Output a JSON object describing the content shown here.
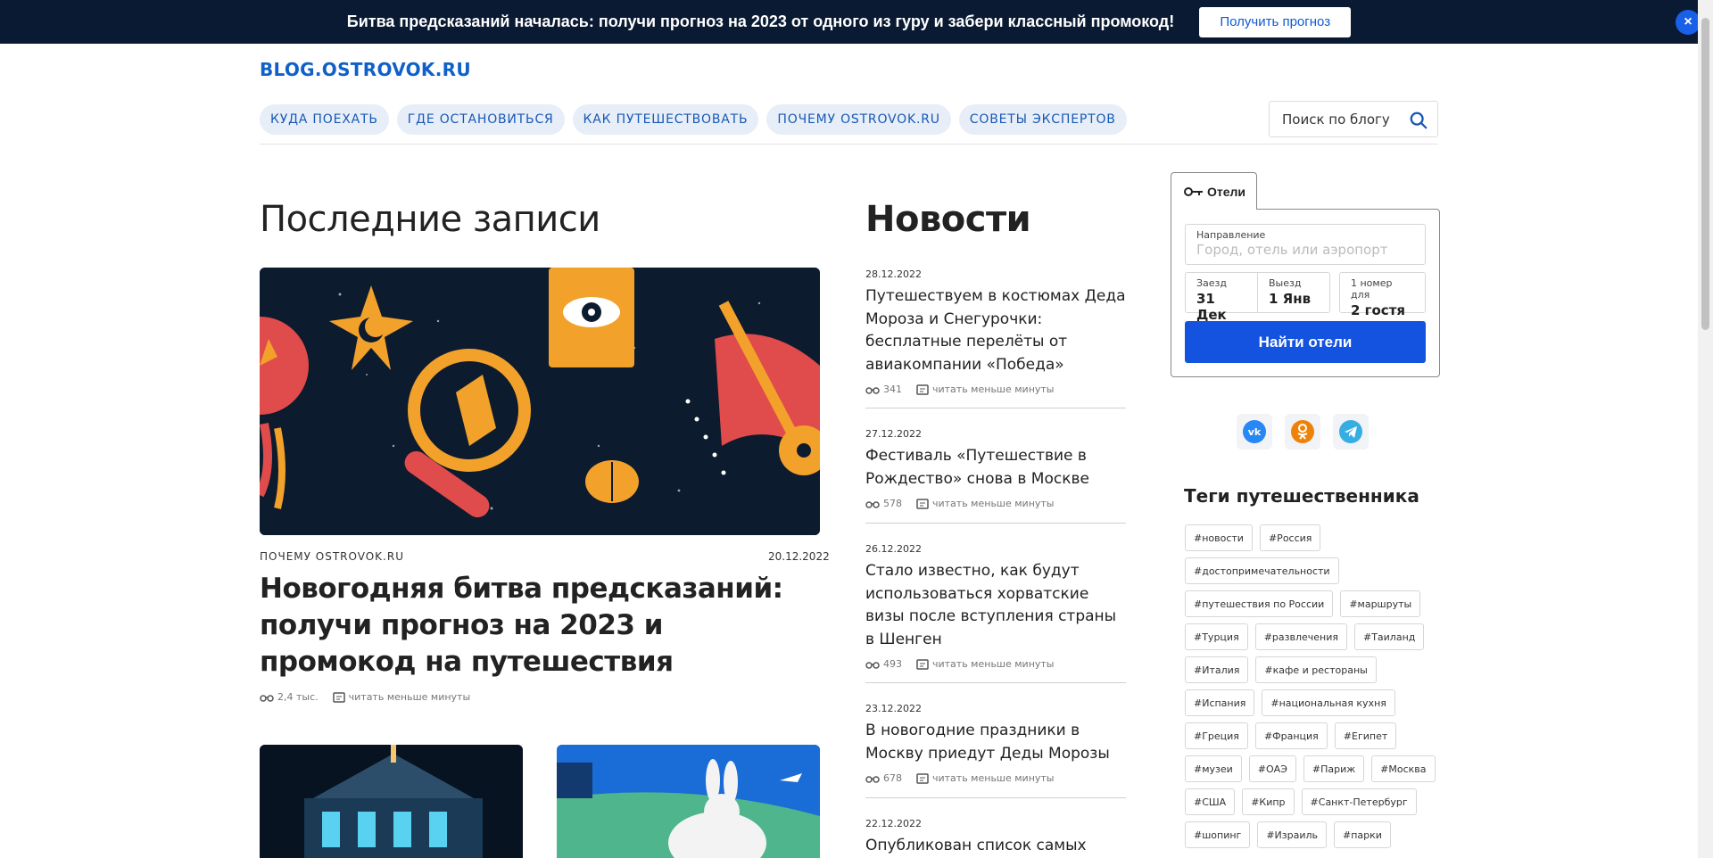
{
  "promo": {
    "text": "Битва предсказаний началась: получи прогноз на 2023 от одного из гуру и забери классный промокод!",
    "button": "Получить прогноз",
    "close": "×"
  },
  "header": {
    "logo": "BLOG.OSTROVOK.RU",
    "nav": [
      "КУДА ПОЕХАТЬ",
      "ГДЕ ОСТАНОВИТЬСЯ",
      "КАК ПУТЕШЕСТВОВАТЬ",
      "ПОЧЕМУ OSTROVOK.RU",
      "СОВЕТЫ ЭКСПЕРТОВ"
    ],
    "search_placeholder": "Поиск по блогу"
  },
  "latest": {
    "heading": "Последние записи",
    "featured": {
      "category": "ПОЧЕМУ OSTROVOK.RU",
      "date": "20.12.2022",
      "title": "Новогодняя битва предсказаний: получи прогноз на 2023 и промокод на путешествия",
      "views": "2,4 тыс.",
      "read_time": "читать меньше минуты"
    }
  },
  "news": {
    "heading": "Новости",
    "items": [
      {
        "date": "28.12.2022",
        "title": "Путешествуем в костюмах Деда Мороза и Снегурочки: бесплатные перелёты от авиакомпании «Победа»",
        "views": "341",
        "read_time": "читать меньше минуты"
      },
      {
        "date": "27.12.2022",
        "title": "Фестиваль «Путешествие в Рождество» снова в Москве",
        "views": "578",
        "read_time": "читать меньше минуты"
      },
      {
        "date": "26.12.2022",
        "title": "Стало известно, как будут использоваться хорватские визы после вступления страны в Шенген",
        "views": "493",
        "read_time": "читать меньше минуты"
      },
      {
        "date": "23.12.2022",
        "title": "В новогодние праздники в Москву приедут Деды Морозы",
        "views": "678",
        "read_time": "читать меньше минуты"
      },
      {
        "date": "22.12.2022",
        "title": "Опубликован список самых"
      }
    ]
  },
  "booking": {
    "tab": "Отели",
    "direction_label": "Направление",
    "direction_placeholder": "Город, отель или аэропорт",
    "checkin_label": "Заезд",
    "checkin_value": "31 Дек",
    "checkout_label": "Выезд",
    "checkout_value": "1 Янв",
    "guests_label": "1 номер для",
    "guests_value": "2 гостя",
    "button": "Найти отели"
  },
  "tags": {
    "heading": "Теги путешественника",
    "items": [
      "#новости",
      "#Россия",
      "#достопримечательности",
      "#путешествия по России",
      "#маршруты",
      "#Турция",
      "#развлечения",
      "#Таиланд",
      "#Италия",
      "#кафе и рестораны",
      "#Испания",
      "#национальная кухня",
      "#Греция",
      "#Франция",
      "#Египет",
      "#музеи",
      "#ОАЭ",
      "#Париж",
      "#Москва",
      "#США",
      "#Кипр",
      "#Санкт-Петербург",
      "#шопинг",
      "#Израиль",
      "#парки"
    ]
  },
  "colors": {
    "brand": "#1060c9",
    "promo_bg": "#0a1a33",
    "accent_button": "#1452e0"
  }
}
